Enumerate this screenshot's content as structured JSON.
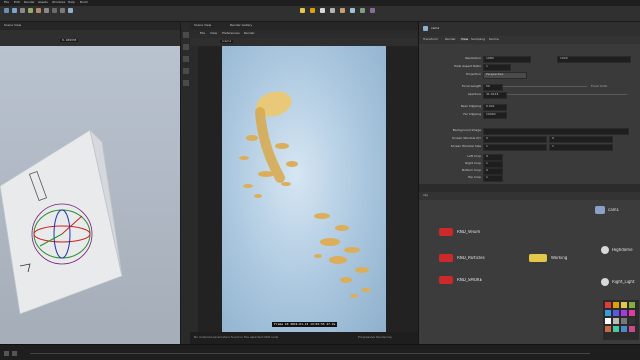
{
  "menubar": {
    "items": [
      "File",
      "Edit",
      "Render",
      "Assets",
      "Windows",
      "Help",
      "Build"
    ]
  },
  "viewport": {
    "tab_label": "Scene View",
    "toolbar_value": "0.109333"
  },
  "render_view": {
    "tabs": [
      "Scene View",
      "Render Gallery"
    ],
    "menu": [
      "File",
      "View",
      "Preferences",
      "Render"
    ],
    "camera_value": "/cam1",
    "status_text": "Frame 10 2019-01-13 14:02:55 27.9s",
    "footer_text": "No material parameters found in the selected USD node",
    "progress_label": "Progressive Rendering"
  },
  "params": {
    "header_path": "cam1",
    "tabs": [
      "Transform",
      "Render",
      "View",
      "Sampling",
      "Karma"
    ],
    "rows": [
      {
        "label": "Resolution",
        "value": "1080",
        "value2": "1920"
      },
      {
        "label": "Pixel Aspect Ratio",
        "value": "1"
      },
      {
        "label": "Projection",
        "value": "Perspective"
      },
      {
        "label": "Focal Length",
        "value": "50",
        "unit": "Focal Units"
      },
      {
        "label": "Aperture",
        "value": "41.4214"
      },
      {
        "label": "Near Clipping",
        "value": "0.001"
      },
      {
        "label": "Far Clipping",
        "value": "10000"
      },
      {
        "label": "Background Image",
        "value": ""
      },
      {
        "label": "Screen Window X/Y",
        "value": "0",
        "value2": "0"
      },
      {
        "label": "Screen Window Size",
        "value": "1",
        "value2": "1"
      },
      {
        "label": "Left Crop",
        "value": "0"
      },
      {
        "label": "Right Crop",
        "value": "1"
      },
      {
        "label": "Bottom Crop",
        "value": "0"
      },
      {
        "label": "Top Crop",
        "value": "1"
      }
    ]
  },
  "network": {
    "path_label": "obj",
    "nodes": [
      {
        "label": "RND_Velum",
        "color": "#cc2a2a"
      },
      {
        "label": "RND_Particles",
        "color": "#cc2a2a"
      },
      {
        "label": "RND_SMOKE",
        "color": "#cc2a2a"
      },
      {
        "label": "Working",
        "color": "#e3c84a"
      },
      {
        "label": "Highdome",
        "color": "#d8d8d8"
      },
      {
        "label": "Right_Light",
        "color": "#d8d8d8"
      },
      {
        "label": "cam1",
        "color": "#8aa0c8"
      }
    ]
  },
  "colors": {
    "accent": "#e0a100",
    "bg_sky": "#a9c6de"
  }
}
